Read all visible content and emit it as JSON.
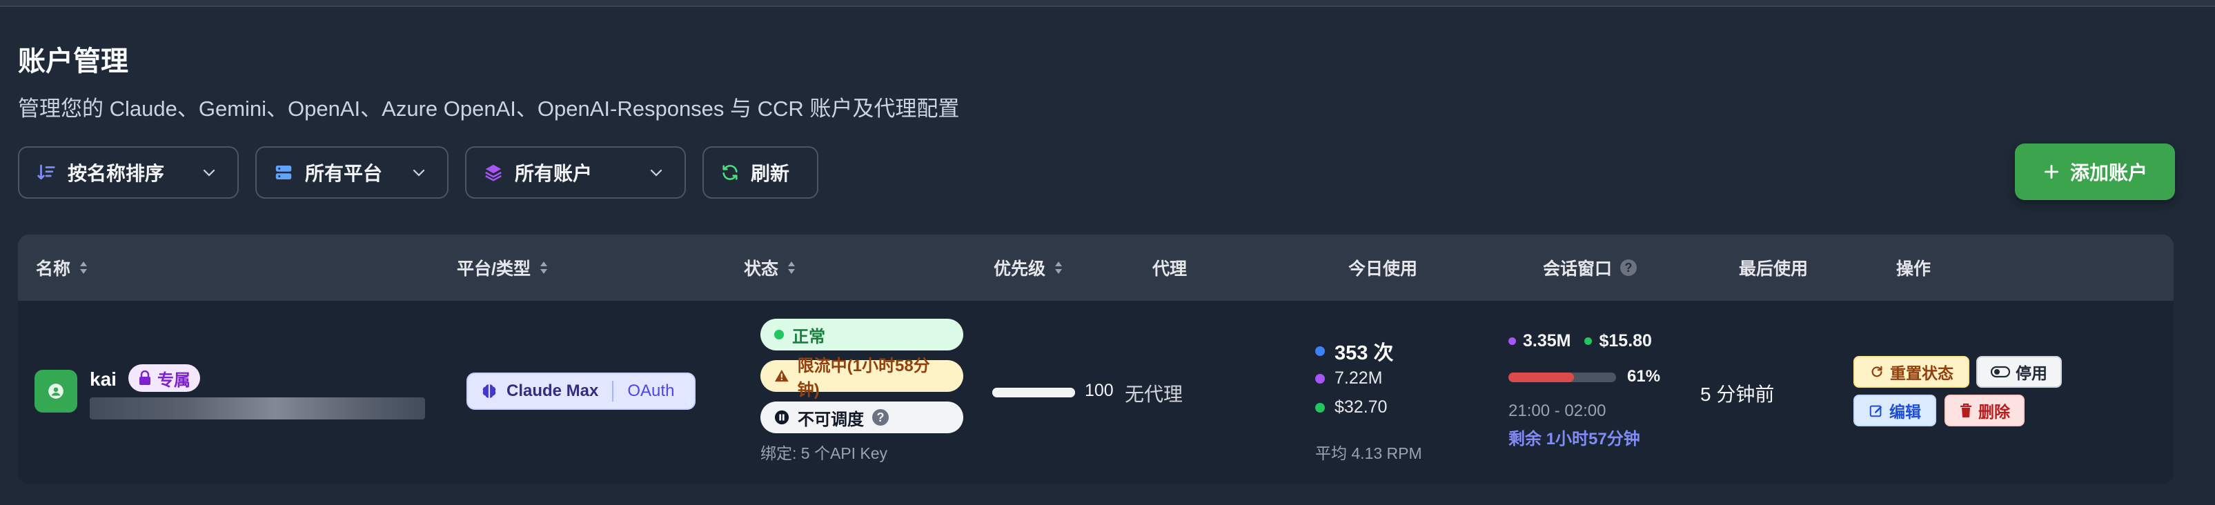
{
  "header": {
    "title": "账户管理",
    "subtitle": "管理您的 Claude、Gemini、OpenAI、Azure OpenAI、OpenAI-Responses 与 CCR 账户及代理配置"
  },
  "toolbar": {
    "sort_label": "按名称排序",
    "platform_label": "所有平台",
    "account_filter_label": "所有账户",
    "refresh_label": "刷新",
    "add_label": "添加账户"
  },
  "table": {
    "columns": {
      "name": "名称",
      "platform": "平台/类型",
      "status": "状态",
      "priority": "优先级",
      "proxy": "代理",
      "today_usage": "今日使用",
      "session_window": "会话窗口",
      "last_used": "最后使用",
      "actions": "操作"
    },
    "rows": [
      {
        "name": "kai",
        "owned_badge": "专属",
        "platform": "Claude Max",
        "auth_type": "OAuth",
        "status_normal": "正常",
        "status_limited": "限流中(1小时58分钟)",
        "status_unschedulable": "不可调度",
        "bound_keys": "绑定: 5 个API Key",
        "priority": "100",
        "priority_fraction": 1.0,
        "proxy": "无代理",
        "usage_requests": "353 次",
        "usage_tokens": "7.22M",
        "usage_cost": "$32.70",
        "usage_rpm": "平均 4.13 RPM",
        "session_tokens": "3.35M",
        "session_cost": "$15.80",
        "session_percent": "61%",
        "session_fraction": 0.61,
        "session_time": "21:00 - 02:00",
        "session_remaining": "剩余 1小时57分钟",
        "last_used": "5 分钟前",
        "action_reset": "重置状态",
        "action_disable": "停用",
        "action_edit": "编辑",
        "action_delete": "删除"
      }
    ]
  },
  "colors": {
    "accent_green": "#3ba44d",
    "dot_blue": "#3b82f6",
    "dot_purple": "#a855f7",
    "dot_green": "#22c55e",
    "session_bar": "#dc4a4a"
  }
}
